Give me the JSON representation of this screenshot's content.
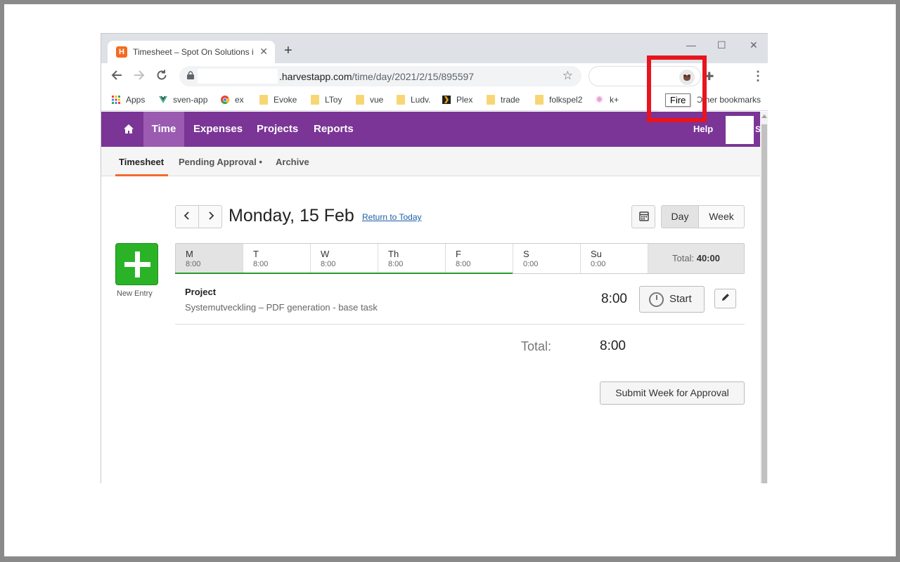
{
  "browser": {
    "tab_title": "Timesheet – Spot On Solutions i",
    "favicon_letter": "H",
    "tab_close": "✕",
    "new_tab": "+",
    "window_controls": {
      "minimize": "—",
      "maximize": "☐",
      "close": "✕"
    },
    "url_host": ".harvestapp.com",
    "url_path": "/time/day/2021/2/15/895597",
    "tooltip": "Fire",
    "bookmarks": [
      "Apps",
      "sven-app",
      "ex",
      "Evoke",
      "LToy",
      "vue",
      "Ludv.",
      "Plex",
      "trade",
      "folkspel2",
      "k+"
    ],
    "other_bookmarks": "Other bookmarks"
  },
  "app": {
    "nav": {
      "time": "Time",
      "expenses": "Expenses",
      "projects": "Projects",
      "reports": "Reports",
      "help": "Help",
      "avatar_initial": "S"
    },
    "subnav": {
      "timesheet": "Timesheet",
      "pending": "Pending Approval •",
      "archive": "Archive"
    },
    "date_title": "Monday, 15 Feb",
    "return_today": "Return to Today",
    "view": {
      "day": "Day",
      "week": "Week"
    },
    "new_entry": "New Entry",
    "days": [
      {
        "name": "M",
        "hours": "8:00"
      },
      {
        "name": "T",
        "hours": "8:00"
      },
      {
        "name": "W",
        "hours": "8:00"
      },
      {
        "name": "Th",
        "hours": "8:00"
      },
      {
        "name": "F",
        "hours": "8:00"
      },
      {
        "name": "S",
        "hours": "0:00"
      },
      {
        "name": "Su",
        "hours": "0:00"
      }
    ],
    "week_total_label": "Total:",
    "week_total_value": "40:00",
    "entry": {
      "project": "Project",
      "task": "Systemutveckling  –  PDF generation - base task",
      "hours": "8:00",
      "start_label": "Start"
    },
    "total_label": "Total:",
    "total_value": "8:00",
    "submit_label": "Submit Week for Approval"
  },
  "colors": {
    "nav_purple": "#7b3596",
    "accent_orange": "#f26a2e",
    "new_entry_green": "#2bb328",
    "highlight_red": "#e8141e"
  }
}
